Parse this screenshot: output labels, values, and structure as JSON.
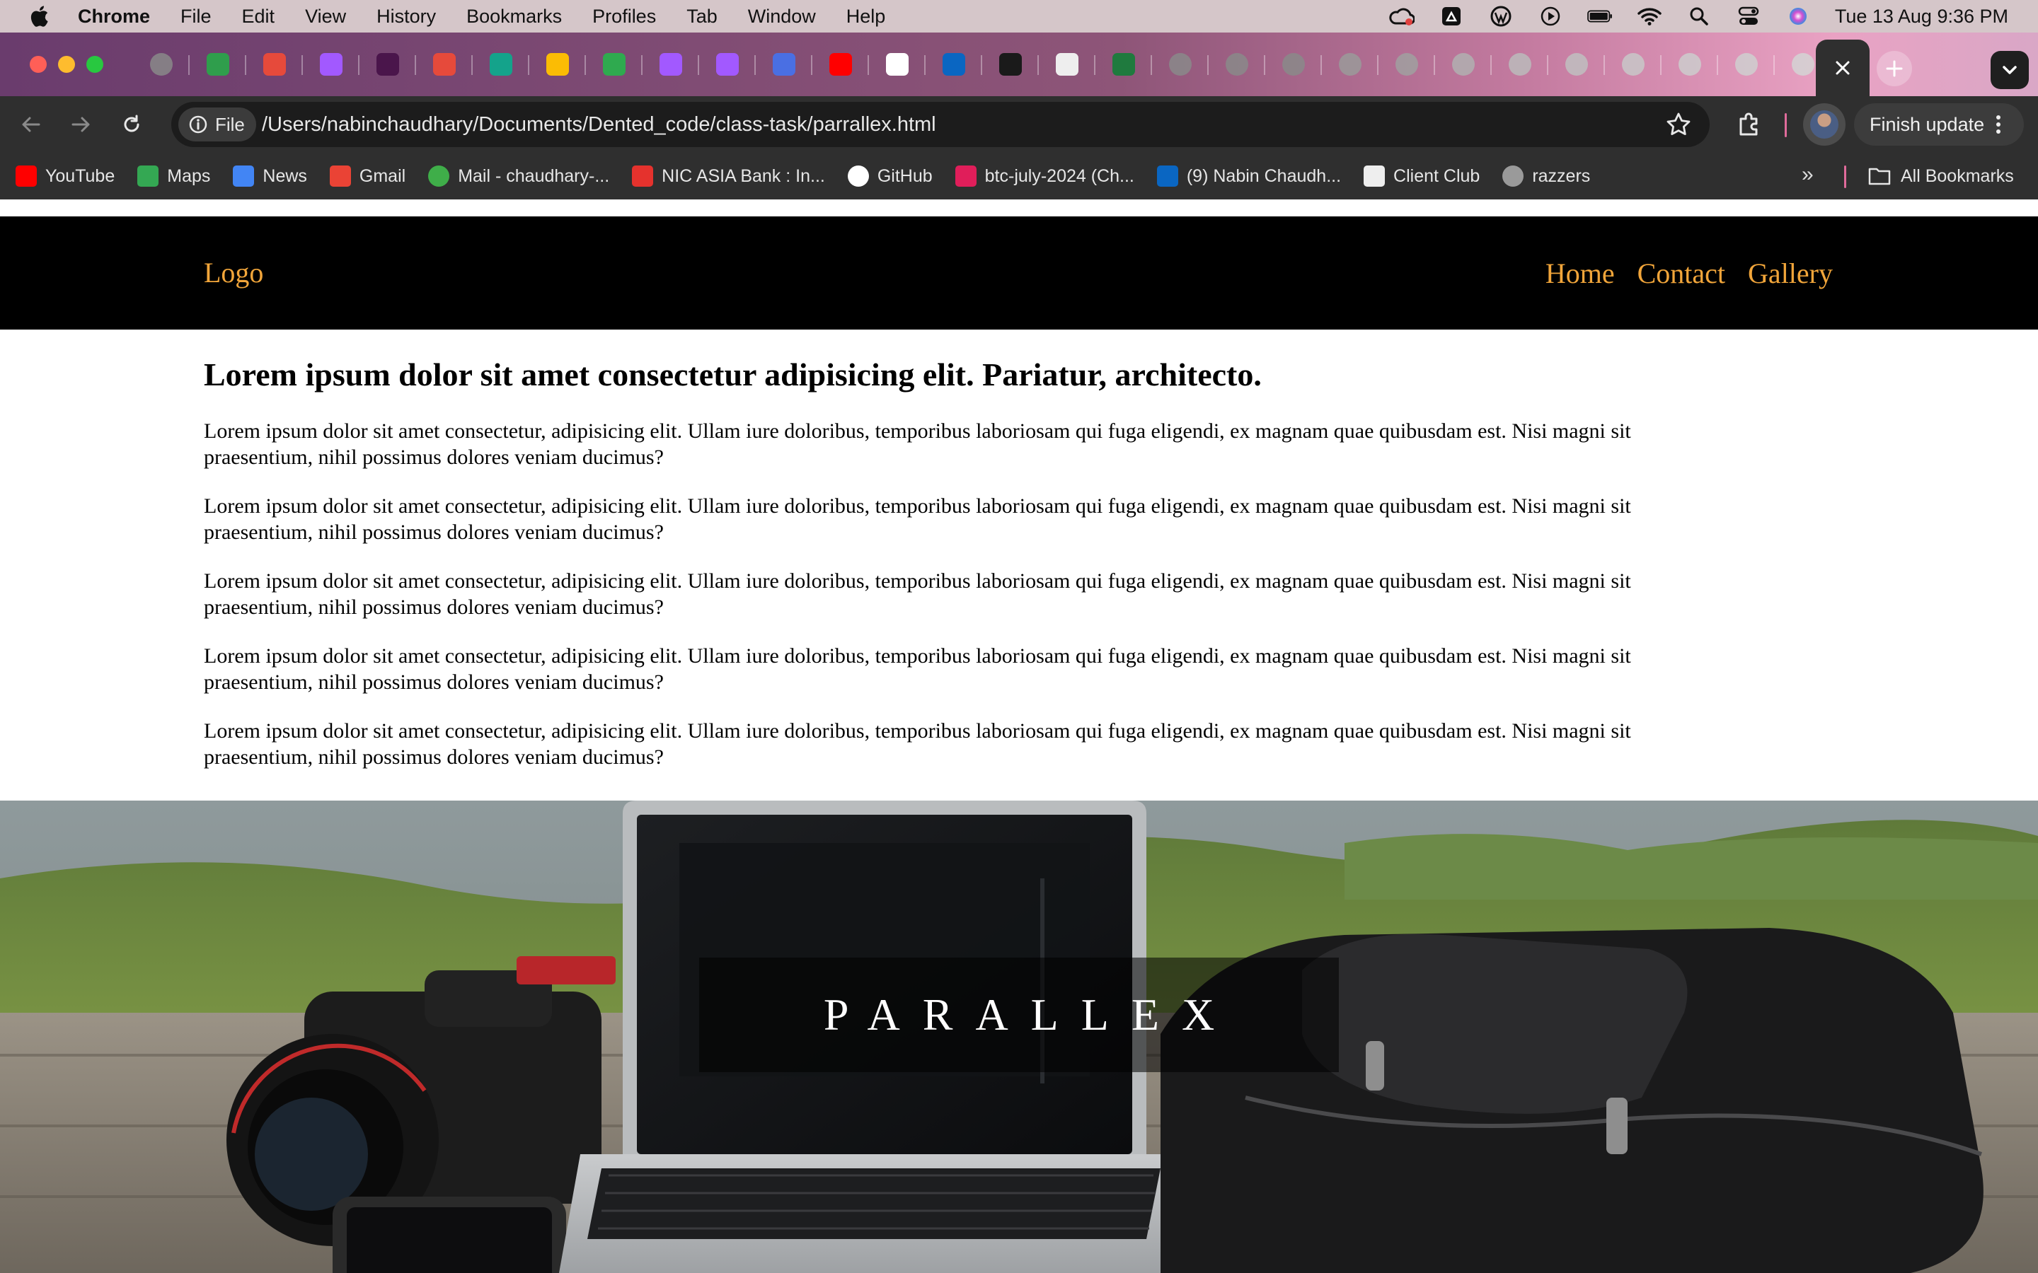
{
  "menubar": {
    "app_name": "Chrome",
    "items": [
      "File",
      "Edit",
      "View",
      "History",
      "Bookmarks",
      "Profiles",
      "Tab",
      "Window",
      "Help"
    ],
    "clock": "Tue 13 Aug  9:36 PM"
  },
  "browser": {
    "url": "/Users/nabinchaudhary/Documents/Dented_code/class-task/parrallex.html",
    "file_chip": "File",
    "finish_update_label": "Finish update"
  },
  "tabs": [
    {
      "icon": "globe-icon",
      "color": "#8a8a8a"
    },
    {
      "icon": "drive-icon",
      "color": "#2f9e4c"
    },
    {
      "icon": "trello-icon",
      "color": "#e64a3b"
    },
    {
      "icon": "figma-icon",
      "color": "#a259ff"
    },
    {
      "icon": "slack-icon",
      "color": "#4a154b"
    },
    {
      "icon": "trello-icon",
      "color": "#e64a3b"
    },
    {
      "icon": "pen-icon",
      "color": "#14a38b"
    },
    {
      "icon": "ads-icon",
      "color": "#fbbc04"
    },
    {
      "icon": "px-icon",
      "color": "#2faa4f"
    },
    {
      "icon": "figma-icon",
      "color": "#a259ff"
    },
    {
      "icon": "figma-icon",
      "color": "#a259ff"
    },
    {
      "icon": "flag-icon",
      "color": "#4a6fe3"
    },
    {
      "icon": "youtube-icon",
      "color": "#ff0000"
    },
    {
      "icon": "google-icon",
      "color": "#ffffff"
    },
    {
      "icon": "linkedin-icon",
      "color": "#0a66c2"
    },
    {
      "icon": "github-icon",
      "color": "#1a1a1a"
    },
    {
      "icon": "page-icon",
      "color": "#eeeeee"
    },
    {
      "icon": "w-icon",
      "color": "#1f7a3e"
    },
    {
      "icon": "globe-icon",
      "color": "#8a8a8a"
    },
    {
      "icon": "globe-icon",
      "color": "#8a8a8a"
    },
    {
      "icon": "globe-icon",
      "color": "#8a8a8a"
    },
    {
      "icon": "globe-icon",
      "color": "#9a9a9a"
    },
    {
      "icon": "globe-icon",
      "color": "#a0a0a0"
    },
    {
      "icon": "globe-icon",
      "color": "#b0b0b0"
    },
    {
      "icon": "globe-icon",
      "color": "#bbbbbb"
    },
    {
      "icon": "globe-icon",
      "color": "#c0c0c0"
    },
    {
      "icon": "globe-icon",
      "color": "#c8c8c8"
    },
    {
      "icon": "globe-icon",
      "color": "#cccccc"
    },
    {
      "icon": "globe-icon",
      "color": "#cfcfcf"
    },
    {
      "icon": "globe-icon",
      "color": "#d4d4d4"
    }
  ],
  "bookmarks": [
    {
      "label": "YouTube",
      "icon": "youtube-icon",
      "color": "#ff0000"
    },
    {
      "label": "Maps",
      "icon": "maps-icon",
      "color": "#34a853"
    },
    {
      "label": "News",
      "icon": "news-icon",
      "color": "#4285f4"
    },
    {
      "label": "Gmail",
      "icon": "gmail-icon",
      "color": "#ea4335"
    },
    {
      "label": "Mail - chaudhary-...",
      "icon": "mail-icon",
      "color": "#3fae49"
    },
    {
      "label": "NIC ASIA Bank : In...",
      "icon": "bank-icon",
      "color": "#e5322d"
    },
    {
      "label": "GitHub",
      "icon": "github-icon",
      "color": "#ffffff"
    },
    {
      "label": "btc-july-2024 (Ch...",
      "icon": "slack-icon",
      "color": "#e01e5a"
    },
    {
      "label": "(9) Nabin Chaudh...",
      "icon": "linkedin-icon",
      "color": "#0a66c2"
    },
    {
      "label": "Client Club",
      "icon": "page-icon",
      "color": "#eeeeee"
    },
    {
      "label": "razzers",
      "icon": "globe-icon",
      "color": "#9a9a9a"
    }
  ],
  "all_bookmarks_label": "All Bookmarks",
  "page": {
    "logo": "Logo",
    "nav": [
      "Home",
      "Contact",
      "Gallery"
    ],
    "heading": "Lorem ipsum dolor sit amet consectetur adipisicing elit. Pariatur, architecto.",
    "paragraphs": [
      "Lorem ipsum dolor sit amet consectetur, adipisicing elit. Ullam iure doloribus, temporibus laboriosam qui fuga eligendi, ex magnam quae quibusdam est. Nisi magni sit praesentium, nihil possimus dolores veniam ducimus?",
      "Lorem ipsum dolor sit amet consectetur, adipisicing elit. Ullam iure doloribus, temporibus laboriosam qui fuga eligendi, ex magnam quae quibusdam est. Nisi magni sit praesentium, nihil possimus dolores veniam ducimus?",
      "Lorem ipsum dolor sit amet consectetur, adipisicing elit. Ullam iure doloribus, temporibus laboriosam qui fuga eligendi, ex magnam quae quibusdam est. Nisi magni sit praesentium, nihil possimus dolores veniam ducimus?",
      "Lorem ipsum dolor sit amet consectetur, adipisicing elit. Ullam iure doloribus, temporibus laboriosam qui fuga eligendi, ex magnam quae quibusdam est. Nisi magni sit praesentium, nihil possimus dolores veniam ducimus?",
      "Lorem ipsum dolor sit amet consectetur, adipisicing elit. Ullam iure doloribus, temporibus laboriosam qui fuga eligendi, ex magnam quae quibusdam est. Nisi magni sit praesentium, nihil possimus dolores veniam ducimus?"
    ],
    "hero_caption": "PARALLEX"
  },
  "colors": {
    "nav_accent": "#f1a53a",
    "navbar_bg": "#000000",
    "traffic_red": "#ff5f57",
    "traffic_yellow": "#febc2e",
    "traffic_green": "#28c840"
  }
}
